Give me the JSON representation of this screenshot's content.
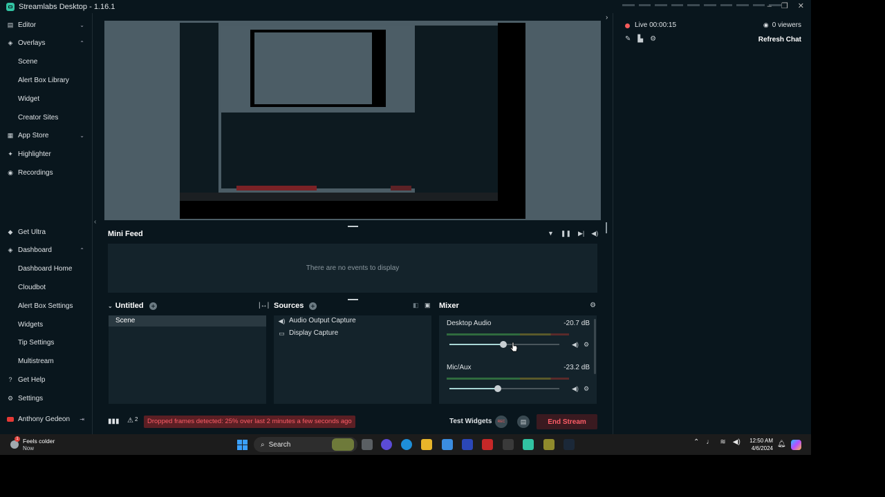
{
  "window": {
    "title": "Streamlabs Desktop - 1.16.1",
    "controls": [
      "–",
      "❐",
      "✕"
    ]
  },
  "sidebar": {
    "top": [
      {
        "label": "Editor",
        "icon": "editor-icon",
        "chev": "⌄"
      },
      {
        "label": "Overlays",
        "icon": "overlays-icon",
        "chev": "⌃"
      },
      {
        "label": "Scene",
        "sub": true
      },
      {
        "label": "Alert Box Library",
        "sub": true
      },
      {
        "label": "Widget",
        "sub": true
      },
      {
        "label": "Creator Sites",
        "sub": true
      },
      {
        "label": "App Store",
        "icon": "app-store-icon",
        "chev": "⌄"
      },
      {
        "label": "Highlighter",
        "icon": "highlighter-icon"
      },
      {
        "label": "Recordings",
        "icon": "recordings-icon"
      }
    ],
    "bottom": [
      {
        "label": "Get Ultra",
        "icon": "ultra-icon"
      },
      {
        "label": "Dashboard",
        "icon": "dashboard-icon",
        "chev": "⌃"
      },
      {
        "label": "Dashboard Home",
        "sub": true
      },
      {
        "label": "Cloudbot",
        "sub": true
      },
      {
        "label": "Alert Box Settings",
        "sub": true
      },
      {
        "label": "Widgets",
        "sub": true
      },
      {
        "label": "Tip Settings",
        "sub": true
      },
      {
        "label": "Multistream",
        "sub": true
      },
      {
        "label": "Get Help",
        "icon": "help-icon"
      },
      {
        "label": "Settings",
        "icon": "settings-icon"
      }
    ],
    "user": {
      "name": "Anthony Gedeon",
      "logout_glyph": "⇥"
    }
  },
  "minifeed": {
    "title": "Mini Feed",
    "empty_text": "There are no events to display"
  },
  "scenes": {
    "title": "Untitled",
    "items": [
      "Scene"
    ]
  },
  "sources": {
    "title": "Sources",
    "items": [
      {
        "label": "Audio Output Capture",
        "icon": "speaker-icon"
      },
      {
        "label": "Display Capture",
        "icon": "monitor-icon"
      }
    ]
  },
  "mixer": {
    "title": "Mixer",
    "channels": [
      {
        "name": "Desktop Audio",
        "db": "-20.7 dB",
        "volume": 0.49
      },
      {
        "name": "Mic/Aux",
        "db": "-23.2 dB",
        "volume": 0.44
      }
    ]
  },
  "footer": {
    "warning_count": "2",
    "warning_text": "Dropped frames detected: 25% over last 2 minutes a few seconds ago",
    "test_widgets": "Test Widgets",
    "rec_label": "REC",
    "end_stream": "End Stream"
  },
  "chat": {
    "live_time": "Live 00:00:15",
    "viewers": "0 viewers",
    "refresh": "Refresh Chat"
  },
  "taskbar": {
    "weather_badge": "1",
    "weather_title": "Feels colder",
    "weather_sub": "Now",
    "search_placeholder": "Search",
    "time": "12:50 AM",
    "date": "4/6/2024"
  },
  "colors": {
    "accent": "#31c3a2",
    "live": "#f45b5b",
    "warning_bg": "#5b1f24",
    "warning_text": "#ff5d67"
  }
}
